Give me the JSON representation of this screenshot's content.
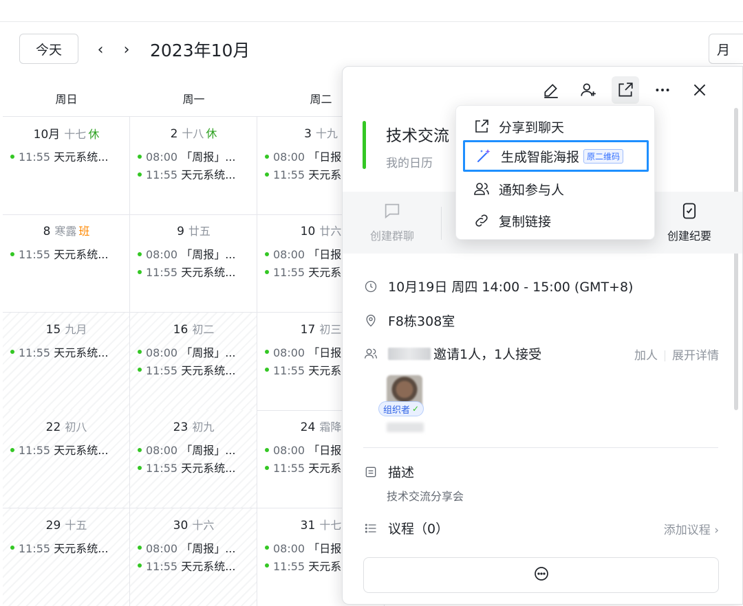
{
  "toolbar": {
    "today_label": "今天",
    "prev_icon": "chevron-left-icon",
    "next_icon": "chevron-right-icon",
    "month_title": "2023年10月",
    "view_label": "月"
  },
  "weekdays": [
    "周日",
    "周一",
    "周二"
  ],
  "weeks": [
    {
      "days": [
        {
          "num": "10月",
          "lunar": "十七",
          "tag": "休",
          "tag_type": "rest",
          "events": [
            {
              "time": "11:55",
              "title": "天元系统..."
            }
          ]
        },
        {
          "num": "2",
          "lunar": "十八",
          "tag": "休",
          "tag_type": "rest",
          "events": [
            {
              "time": "08:00",
              "title": "「周报」..."
            },
            {
              "time": "11:55",
              "title": "天元系统..."
            }
          ]
        },
        {
          "num": "3",
          "lunar": "十九",
          "tag": "",
          "tag_type": "",
          "events": [
            {
              "time": "08:00",
              "title": "「日报"
            },
            {
              "time": "11:55",
              "title": "天元系"
            }
          ]
        }
      ]
    },
    {
      "days": [
        {
          "num": "8",
          "lunar": "寒露",
          "tag": "班",
          "tag_type": "work",
          "events": [
            {
              "time": "11:55",
              "title": "天元系统..."
            }
          ]
        },
        {
          "num": "9",
          "lunar": "廿五",
          "tag": "",
          "tag_type": "",
          "events": [
            {
              "time": "08:00",
              "title": "「周报」..."
            },
            {
              "time": "11:55",
              "title": "天元系统..."
            }
          ]
        },
        {
          "num": "10",
          "lunar": "廿六",
          "tag": "",
          "tag_type": "",
          "events": [
            {
              "time": "08:00",
              "title": "「日报"
            },
            {
              "time": "11:55",
              "title": "天元系"
            }
          ]
        }
      ]
    },
    {
      "days": [
        {
          "num": "15",
          "lunar": "九月",
          "tag": "",
          "tag_type": "",
          "events": [
            {
              "time": "11:55",
              "title": "天元系统..."
            }
          ]
        },
        {
          "num": "16",
          "lunar": "初二",
          "tag": "",
          "tag_type": "",
          "events": [
            {
              "time": "08:00",
              "title": "「周报」..."
            },
            {
              "time": "11:55",
              "title": "天元系统..."
            }
          ]
        },
        {
          "num": "17",
          "lunar": "初三",
          "tag": "",
          "tag_type": "",
          "events": [
            {
              "time": "08:00",
              "title": "「日报"
            },
            {
              "time": "11:55",
              "title": "天元系"
            }
          ]
        }
      ]
    },
    {
      "days": [
        {
          "num": "22",
          "lunar": "初八",
          "tag": "",
          "tag_type": "",
          "events": [
            {
              "time": "11:55",
              "title": "天元系统..."
            }
          ]
        },
        {
          "num": "23",
          "lunar": "初九",
          "tag": "",
          "tag_type": "",
          "events": [
            {
              "time": "08:00",
              "title": "「周报」..."
            },
            {
              "time": "11:55",
              "title": "天元系统..."
            }
          ]
        },
        {
          "num": "24",
          "lunar": "霜降",
          "tag": "",
          "tag_type": "",
          "events": [
            {
              "time": "08:00",
              "title": "「日报"
            },
            {
              "time": "11:55",
              "title": "天元系"
            }
          ]
        }
      ]
    },
    {
      "days": [
        {
          "num": "29",
          "lunar": "十五",
          "tag": "",
          "tag_type": "",
          "events": [
            {
              "time": "11:55",
              "title": "天元系统..."
            }
          ]
        },
        {
          "num": "30",
          "lunar": "十六",
          "tag": "",
          "tag_type": "",
          "events": [
            {
              "time": "08:00",
              "title": "「周报」..."
            },
            {
              "time": "11:55",
              "title": "天元系统..."
            }
          ]
        },
        {
          "num": "31",
          "lunar": "十七",
          "tag": "",
          "tag_type": "",
          "events": [
            {
              "time": "08:00",
              "title": "「日报"
            },
            {
              "time": "11:55",
              "title": "天元系"
            }
          ]
        }
      ]
    }
  ],
  "detail": {
    "title": "技术交流",
    "calendar_name": "我的日历",
    "quick_actions": [
      {
        "label": "创建群聊",
        "icon": "chat-bubble-icon",
        "disabled": true
      },
      {
        "label": "创建纪要",
        "icon": "notes-icon",
        "disabled": false
      }
    ],
    "time": "10月19日 周四 14:00 - 15:00 (GMT+8)",
    "location": "F8栋308室",
    "attendee_summary": "邀请1人，1人接受",
    "add_person": "加人",
    "expand_details": "展开详情",
    "organizer_badge": "组织者",
    "description_heading": "描述",
    "description_text": "技术交流分享会",
    "agenda_label": "议程（0）",
    "add_agenda": "添加议程"
  },
  "share_menu": {
    "items": [
      {
        "label": "分享到聊天",
        "icon": "share-external-icon"
      },
      {
        "label": "生成智能海报",
        "icon": "sparkle-magic-icon",
        "tag": "原二维码",
        "highlighted": true
      },
      {
        "label": "通知参与人",
        "icon": "people-icon"
      },
      {
        "label": "复制链接",
        "icon": "link-icon"
      }
    ]
  },
  "colors": {
    "accent_green": "#34c724",
    "rest_tag": "#2ea121",
    "work_tag": "#ff8800",
    "highlight_border": "#1e8fff",
    "brand_blue": "#3370ff"
  }
}
